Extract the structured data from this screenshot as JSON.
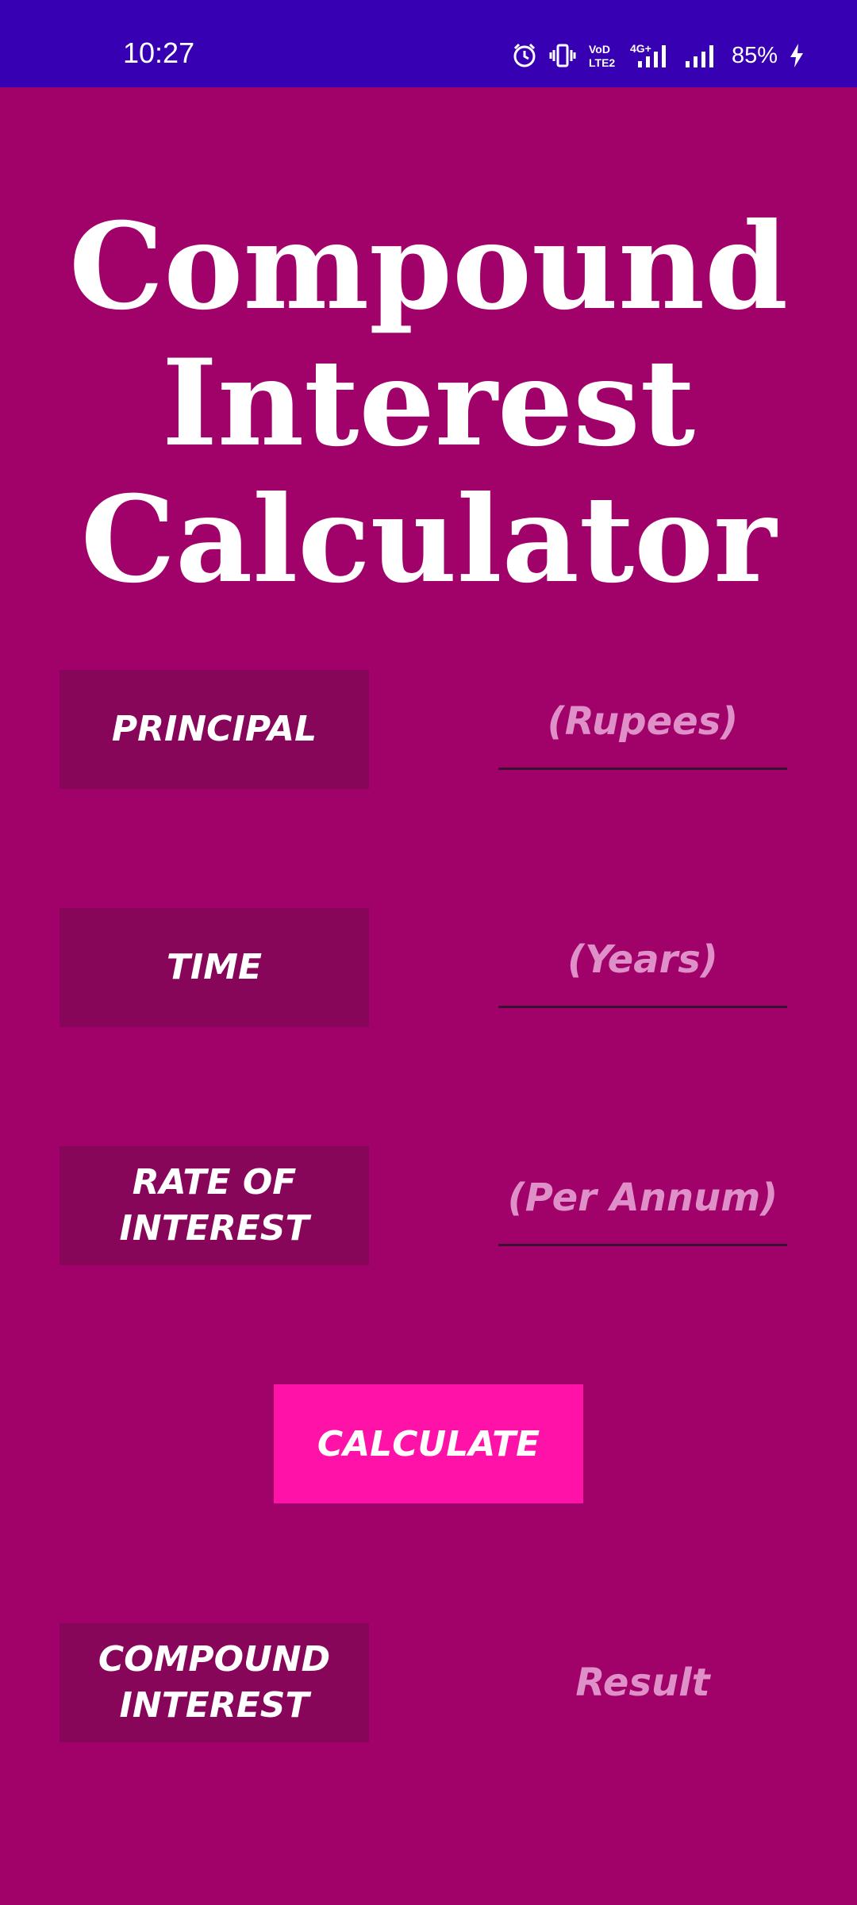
{
  "status_bar": {
    "time": "10:27",
    "battery": "85%",
    "icons": [
      "alarm-icon",
      "vibrate-icon",
      "volte-icon",
      "4g-signal-icon",
      "signal-icon",
      "charging-icon"
    ],
    "network_label": "4G+",
    "volte_label": "VoLTE2"
  },
  "app": {
    "title_lines": [
      "Compound",
      "Interest",
      "Calculator"
    ],
    "background_color": "#a0026a",
    "label_color": "#87065a",
    "button_color": "#ff12a8",
    "hint_color": "#e090c8"
  },
  "fields": {
    "principal": {
      "label": "PRINCIPAL",
      "placeholder": "(Rupees)",
      "value": ""
    },
    "time": {
      "label": "TIME",
      "placeholder": "(Years)",
      "value": ""
    },
    "rate": {
      "label_line1": "RATE OF",
      "label_line2": "INTEREST",
      "placeholder": "(Per Annum)",
      "value": ""
    }
  },
  "calculate_button": {
    "label": "CALCULATE"
  },
  "result": {
    "label_line1": "COMPOUND",
    "label_line2": "INTEREST",
    "value": "Result"
  }
}
